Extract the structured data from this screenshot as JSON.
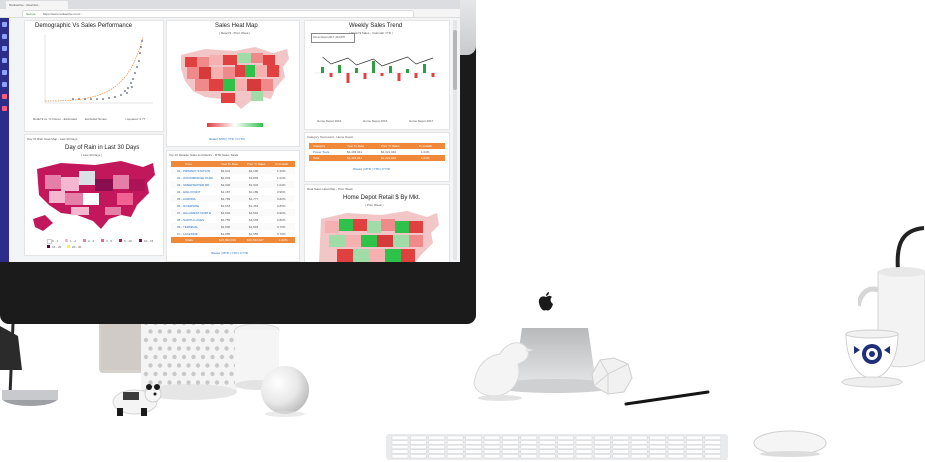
{
  "browser": {
    "tab_title": "Rankactive - Real Est...",
    "secure_label": "Secure",
    "url": "https://www.rankactive.com/..."
  },
  "dashboard": {
    "demographic": {
      "title": "Demographic Vs Sales Performance",
      "legend": [
        "Retail $ vs. % Owner - Estimated",
        "Excluded Series",
        "r-squared: 0.77"
      ]
    },
    "heatmap": {
      "title": "Sales Heat Map",
      "subtitle": "( Retail $ - Prior Week )",
      "link": "Retail | MTD | YTD | CYTD"
    },
    "weekly": {
      "title": "Weekly Sales Trend",
      "subtitle": "( Retail $ Sales - Calendar YTD )",
      "tooltip_label": "Home Depot 2017: 243,878",
      "legend": [
        "Home Depot 2016",
        "Home Depot 2016",
        "Home Depot 2017"
      ]
    },
    "rain": {
      "header": "Day Of Rain Heat Map - Last 30 Days",
      "title": "Day of Rain in Last 30 Days",
      "subtitle": "( Last 30 Days )",
      "legend": [
        "0 - 1",
        "1 - 2",
        "2 - 3",
        "3 - 5",
        "5 - 10",
        "10 - 15",
        "15 - 20",
        "20 - 30"
      ]
    },
    "top_stores": {
      "header": "Top 10 Retailer Stats and Ranks - MTD Sales Totals",
      "columns": [
        "Store",
        "Year To Date",
        "Prior Yr Sales",
        "% Growth"
      ],
      "rows": [
        [
          "01 - PRIMARY STATION",
          "$2,641",
          "$2,190",
          "1.33%"
        ],
        [
          "02 - WOODBRIDGE PARK",
          "$2,003",
          "$1,894",
          "1.02%"
        ],
        [
          "03 - GREENWATER RD",
          "$2,046",
          "$1,934",
          "1.04%"
        ],
        [
          "04 - HIGH POINT",
          "$1,187",
          "$1,189",
          "0.96%"
        ],
        [
          "05 - AURORA",
          "$1,783",
          "$1,777",
          "0.82%"
        ],
        [
          "06 - RIVERSIDE",
          "$1,618",
          "$1,463",
          "0.83%"
        ],
        [
          "07 - HILLCREST NORTH",
          "$1,602",
          "$1,591",
          "0.90%"
        ],
        [
          "08 - NORTH LAKES",
          "$1,756",
          "$1,678",
          "0.89%"
        ],
        [
          "09 - TERMINAL",
          "$1,590",
          "$1,618",
          "0.79%"
        ],
        [
          "10 - LAKESIDE",
          "$1,685",
          "$1,555",
          "0.73%"
        ]
      ],
      "total_label": "Totals",
      "total": [
        "$16,992,034",
        "$16,562,607",
        "1.62%"
      ],
      "link": "Weeks | MTD | YTD | CYTD"
    },
    "category": {
      "header": "Category Scorecard - Home Depot",
      "columns": [
        "Category",
        "Year To Date",
        "Prior Yr Sales",
        "% Growth"
      ],
      "rows": [
        [
          "Power Tools",
          "$4,493,041",
          "$4,321,040",
          "1.04%"
        ]
      ],
      "total_label": "Total",
      "total": [
        "$4,493,041",
        "$4,321,040",
        "1.04%"
      ],
      "link": "Weeks | MTD | YTD | CYTD"
    },
    "retail_map": {
      "header": "Real Sales Heat Map - Prior Week",
      "title": "Home Depot Retail $ By Mkt.",
      "subtitle": "( Prior Week )"
    }
  },
  "colors": {
    "screen_bezel": "#1b1b1b",
    "aluminum": "#d9dadc",
    "sidebar": "#2c2c8a",
    "accent_orange": "#f0883a",
    "heat_red": "#e0403f",
    "heat_green": "#2fc24a",
    "rain_magenta": "#c2185b"
  }
}
